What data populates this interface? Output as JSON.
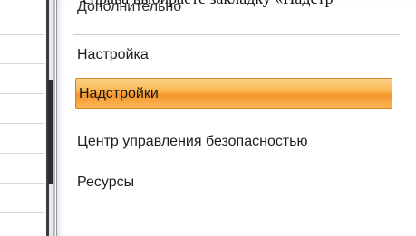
{
  "caption": "справа выбираете закладку «Надстр",
  "nav": {
    "items": [
      {
        "label": "Дополнительно",
        "state": "partially-visible"
      },
      {
        "label": "Настройка",
        "state": "normal"
      },
      {
        "label": "Надстройки",
        "state": "selected"
      },
      {
        "label": "Центр управления безопасностью",
        "state": "normal"
      },
      {
        "label": "Ресурсы",
        "state": "normal"
      }
    ],
    "selected_color_top": "#fbd58d",
    "selected_color_bottom": "#f6962a"
  }
}
